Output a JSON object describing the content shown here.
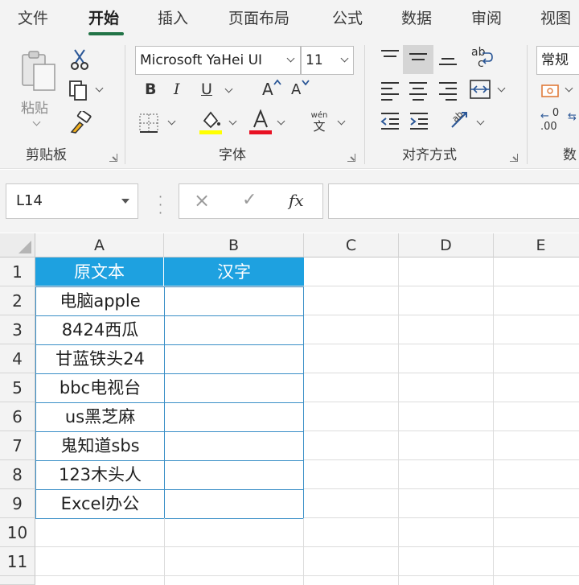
{
  "tabs": [
    {
      "label": "文件",
      "active": false
    },
    {
      "label": "开始",
      "active": true
    },
    {
      "label": "插入",
      "active": false
    },
    {
      "label": "页面布局",
      "active": false
    },
    {
      "label": "公式",
      "active": false
    },
    {
      "label": "数据",
      "active": false
    },
    {
      "label": "审阅",
      "active": false
    },
    {
      "label": "视图",
      "active": false
    }
  ],
  "ribbon": {
    "clipboard": {
      "paste_label": "粘贴",
      "group_label": "剪贴板"
    },
    "font": {
      "font_name": "Microsoft YaHei UI",
      "font_size": "11",
      "bold": "B",
      "italic": "I",
      "underline": "U",
      "grow": "A",
      "shrink": "A",
      "fill_color": "#ffff00",
      "font_color": "#e81123",
      "phonetic_top": "wén",
      "phonetic_bottom": "文",
      "group_label": "字体"
    },
    "alignment": {
      "wrap_glyph": "ab",
      "wrap_glyph2": "c",
      "group_label": "对齐方式"
    },
    "number": {
      "format": "常规",
      "decimals_glyph": ".00",
      "group_label": "数"
    }
  },
  "formula_bar": {
    "name_box": "L14",
    "cancel_symbol": "×",
    "enter_symbol": "✓",
    "fx_label": "fx",
    "content": ""
  },
  "sheet": {
    "columns": [
      "A",
      "B",
      "C",
      "D",
      "E"
    ],
    "rows": [
      "1",
      "2",
      "3",
      "4",
      "5",
      "6",
      "7",
      "8",
      "9",
      "10",
      "11"
    ],
    "header_row": [
      "原文本",
      "汉字"
    ],
    "col_a_values": [
      "电脑apple",
      "8424西瓜",
      "甘蓝铁头24",
      "bbc电视台",
      "us黑芝麻",
      "鬼知道sbs",
      "123木头人",
      "Excel办公"
    ],
    "header_fill": "#1ea1e0",
    "border_color": "#3a8fc7"
  }
}
